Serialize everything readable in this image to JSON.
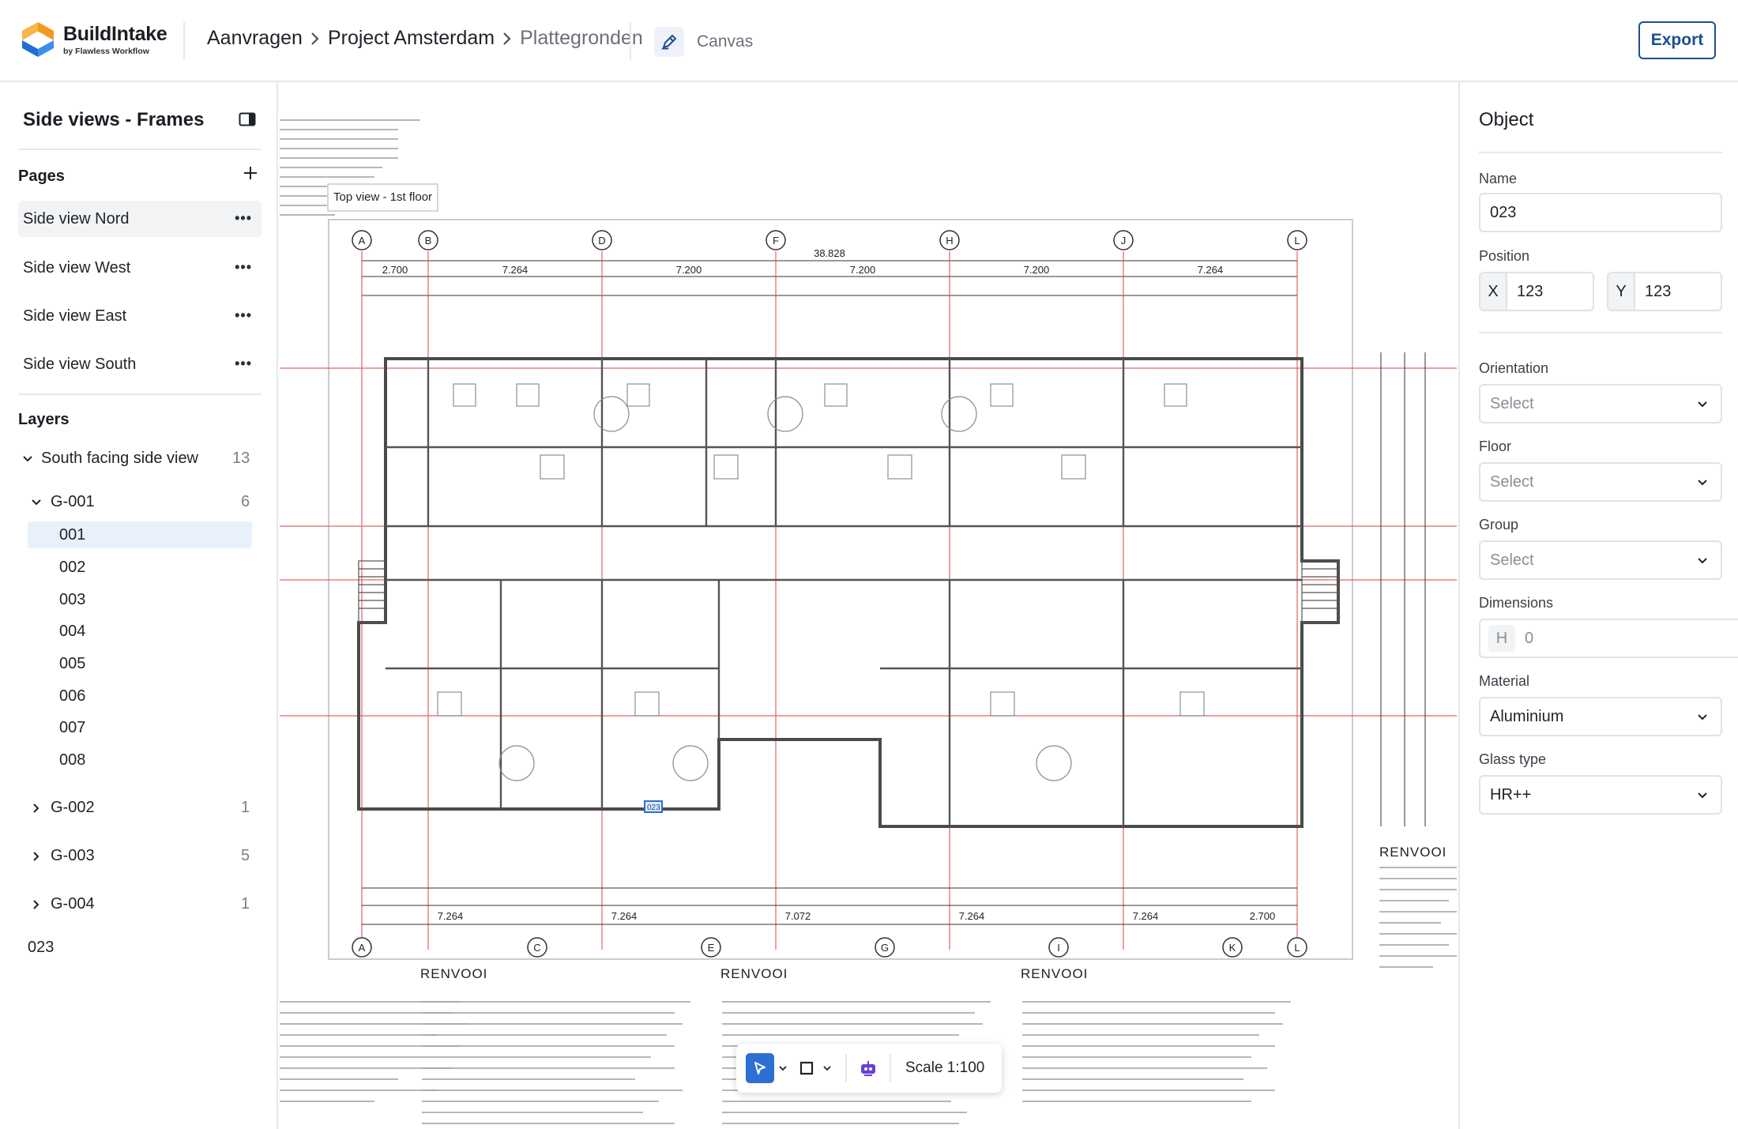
{
  "app": {
    "name": "BuildIntake",
    "subtitle": "by Flawless Workflow",
    "brand_colors": {
      "orange": "#f39a1e",
      "blue": "#1f6fd1",
      "accent": "#1e4f8f"
    }
  },
  "breadcrumb": [
    "Aanvragen",
    "Project Amsterdam",
    "Plattegronden"
  ],
  "canvas_tab": {
    "label": "Canvas",
    "icon": "pencil-icon"
  },
  "export_label": "Export",
  "left_panel": {
    "title": "Side views - Frames",
    "pages_title": "Pages",
    "pages": [
      {
        "label": "Side view Nord",
        "active": true
      },
      {
        "label": "Side view West",
        "active": false
      },
      {
        "label": "Side view East",
        "active": false
      },
      {
        "label": "Side view South",
        "active": false
      }
    ],
    "layers_title": "Layers",
    "layer_group": {
      "label": "South facing side view",
      "count": "13"
    },
    "groups": [
      {
        "label": "G-001",
        "count": "6",
        "expanded": true,
        "items": [
          "001",
          "002",
          "003",
          "004",
          "005",
          "006",
          "007",
          "008"
        ]
      },
      {
        "label": "G-002",
        "count": "1",
        "expanded": false
      },
      {
        "label": "G-003",
        "count": "5",
        "expanded": false
      },
      {
        "label": "G-004",
        "count": "1",
        "expanded": false
      }
    ],
    "selected_item": "001",
    "loose_item": "023"
  },
  "canvas": {
    "sheet_label": "Top view - 1st floor",
    "grid_top": [
      "A",
      "B",
      "D",
      "F",
      "H",
      "J",
      "L"
    ],
    "grid_bottom": [
      "A",
      "C",
      "E",
      "G",
      "I",
      "K",
      "L"
    ],
    "total_dim": "38.828",
    "top_dims": [
      "2.700",
      "7.264",
      "7.200",
      "7.200",
      "7.200",
      "7.264"
    ],
    "bottom_dims": [
      "7.264",
      "7.264",
      "7.072",
      "7.264",
      "7.264",
      "2.700"
    ],
    "legend_title": "RENVOOI",
    "selected_label": "023"
  },
  "toolbar": {
    "tools": [
      "cursor-icon",
      "rectangle-icon",
      "robot-icon"
    ],
    "scale": "Scale 1:100"
  },
  "object_panel": {
    "title": "Object",
    "name_label": "Name",
    "name_value": "023",
    "position_label": "Position",
    "x_prefix": "X",
    "x_value": "123",
    "y_prefix": "Y",
    "y_value": "123",
    "orientation_label": "Orientation",
    "orientation_value": "Select",
    "floor_label": "Floor",
    "floor_value": "Select",
    "group_label": "Group",
    "group_value": "Select",
    "dimensions_label": "Dimensions",
    "h_prefix": "H",
    "h_value": "0",
    "material_label": "Material",
    "material_value": "Aluminium",
    "glass_label": "Glass type",
    "glass_value": "HR++"
  }
}
